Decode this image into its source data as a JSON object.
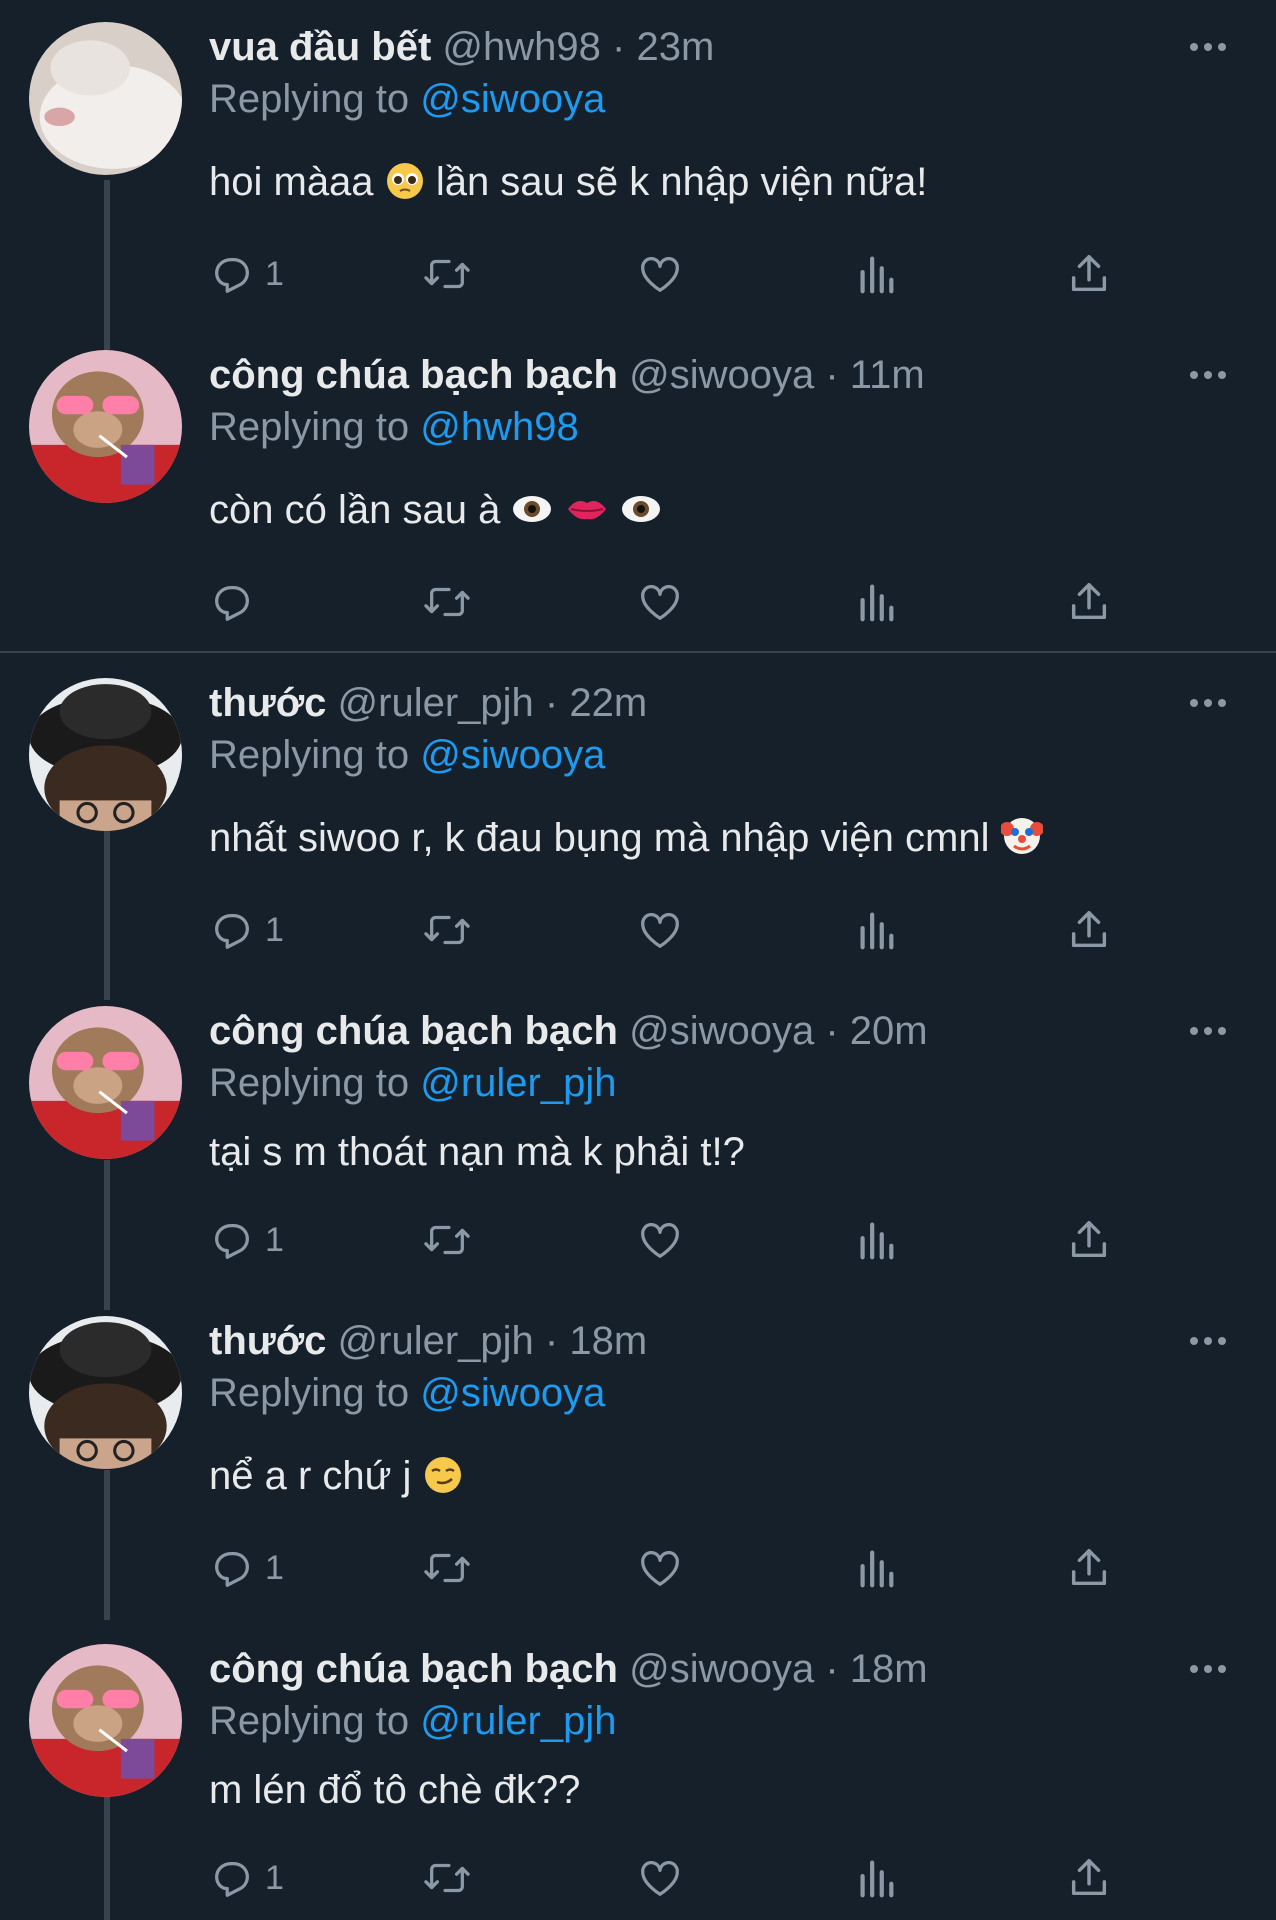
{
  "tweets": [
    {
      "name": "vua đầu bết",
      "handle": "@hwh98",
      "sep": "·",
      "time": "23m",
      "reply_prefix": "Replying to",
      "reply_to": "@siwooya",
      "text": "hoi màaa",
      "emoji": "pleading-face",
      "text_after": "lần sau sẽ k nhập viện nữa!",
      "reply_count": "1",
      "avatar": "white-cat"
    },
    {
      "name": "công chúa bạch bạch",
      "handle": "@siwooya",
      "sep": "·",
      "time": "11m",
      "reply_prefix": "Replying to",
      "reply_to": "@hwh98",
      "text": "còn có lần sau à",
      "emoji": "eye-lips-eye",
      "text_after": "",
      "reply_count": "",
      "avatar": "monkey-pink-glasses"
    },
    {
      "name": "thước",
      "handle": "@ruler_pjh",
      "sep": "·",
      "time": "22m",
      "reply_prefix": "Replying to",
      "reply_to": "@siwooya",
      "text": "nhất siwoo r, k đau bụng mà nhập viện cmnl",
      "emoji": "clown-face",
      "text_after": "",
      "reply_count": "1",
      "avatar": "person-black-hat"
    },
    {
      "name": "công chúa bạch bạch",
      "handle": "@siwooya",
      "sep": "·",
      "time": "20m",
      "reply_prefix": "Replying to",
      "reply_to": "@ruler_pjh",
      "text": "tại s m thoát nạn mà k phải t!?",
      "emoji": "",
      "text_after": "",
      "reply_count": "1",
      "avatar": "monkey-pink-glasses"
    },
    {
      "name": "thước",
      "handle": "@ruler_pjh",
      "sep": "·",
      "time": "18m",
      "reply_prefix": "Replying to",
      "reply_to": "@siwooya",
      "text": "nể a r chứ j",
      "emoji": "smirking-face",
      "text_after": "",
      "reply_count": "1",
      "avatar": "person-black-hat"
    },
    {
      "name": "công chúa bạch bạch",
      "handle": "@siwooya",
      "sep": "·",
      "time": "18m",
      "reply_prefix": "Replying to",
      "reply_to": "@ruler_pjh",
      "text": "m lén đổ tô chè đk??",
      "emoji": "",
      "text_after": "",
      "reply_count": "1",
      "avatar": "monkey-pink-glasses"
    }
  ],
  "icons": {
    "reply": "reply-icon",
    "retweet": "retweet-icon",
    "like": "heart-icon",
    "views": "views-icon",
    "share": "share-icon",
    "more": "more-icon"
  },
  "colors": {
    "background": "#15202b",
    "link": "#1d9bf0",
    "secondary": "#8b98a5",
    "line": "#38444d"
  }
}
